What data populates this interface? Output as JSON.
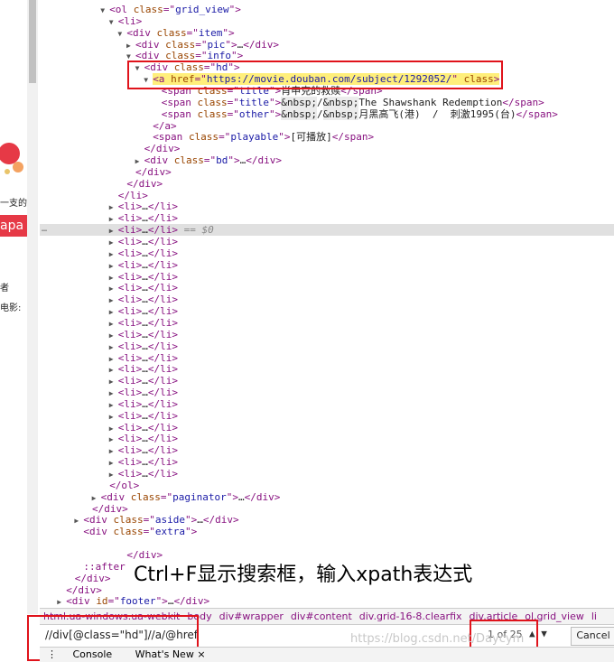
{
  "left_page": {
    "text1": "一支的",
    "text2": "apa",
    "text3": "者",
    "text4": "电影:"
  },
  "dom_lines": [
    {
      "indent": 7,
      "arrow": "▼",
      "parts": [
        [
          "tag",
          "<ol "
        ],
        [
          "attr",
          "class"
        ],
        [
          "tag",
          "=\""
        ],
        [
          "val",
          "grid_view"
        ],
        [
          "tag",
          "\">"
        ]
      ]
    },
    {
      "indent": 8,
      "arrow": "▼",
      "parts": [
        [
          "tag",
          "<li>"
        ]
      ]
    },
    {
      "indent": 9,
      "arrow": "▼",
      "parts": [
        [
          "tag",
          "<div "
        ],
        [
          "attr",
          "class"
        ],
        [
          "tag",
          "=\""
        ],
        [
          "val",
          "item"
        ],
        [
          "tag",
          "\">"
        ]
      ]
    },
    {
      "indent": 10,
      "arrow": "▶",
      "parts": [
        [
          "tag",
          "<div "
        ],
        [
          "attr",
          "class"
        ],
        [
          "tag",
          "=\""
        ],
        [
          "val",
          "pic"
        ],
        [
          "tag",
          "\">"
        ],
        [
          "txt",
          "…"
        ],
        [
          "tag",
          "</div>"
        ]
      ]
    },
    {
      "indent": 10,
      "arrow": "▼",
      "parts": [
        [
          "tag",
          "<div "
        ],
        [
          "attr",
          "class"
        ],
        [
          "tag",
          "=\""
        ],
        [
          "val",
          "info"
        ],
        [
          "tag",
          "\">"
        ]
      ]
    },
    {
      "indent": 11,
      "arrow": "▼",
      "parts": [
        [
          "tag",
          "<div "
        ],
        [
          "attr",
          "class"
        ],
        [
          "tag",
          "=\""
        ],
        [
          "val",
          "hd"
        ],
        [
          "tag",
          "\">"
        ]
      ]
    },
    {
      "indent": 12,
      "arrow": "▼",
      "hl": true,
      "parts": [
        [
          "tag",
          "<a "
        ],
        [
          "attr",
          "href"
        ],
        [
          "tag",
          "=\""
        ],
        [
          "val",
          "https://movie.douban.com/subject/1292052/"
        ],
        [
          "tag",
          "\" "
        ],
        [
          "attr",
          "class"
        ],
        [
          "tag",
          ">"
        ]
      ]
    },
    {
      "indent": 13,
      "arrow": "",
      "parts": [
        [
          "tag",
          "<span "
        ],
        [
          "attr",
          "class"
        ],
        [
          "tag",
          "=\""
        ],
        [
          "val",
          "title"
        ],
        [
          "tag",
          "\">"
        ],
        [
          "txt",
          "肖申克的救赎"
        ],
        [
          "tag",
          "</span>"
        ]
      ]
    },
    {
      "indent": 13,
      "arrow": "",
      "parts": [
        [
          "tag",
          "<span "
        ],
        [
          "attr",
          "class"
        ],
        [
          "tag",
          "=\""
        ],
        [
          "val",
          "title"
        ],
        [
          "tag",
          "\">"
        ],
        [
          "ent",
          "&nbsp;"
        ],
        [
          "txt",
          "/"
        ],
        [
          "ent",
          "&nbsp;"
        ],
        [
          "txt",
          "The Shawshank Redemption"
        ],
        [
          "tag",
          "</span>"
        ]
      ]
    },
    {
      "indent": 13,
      "arrow": "",
      "parts": [
        [
          "tag",
          "<span "
        ],
        [
          "attr",
          "class"
        ],
        [
          "tag",
          "=\""
        ],
        [
          "val",
          "other"
        ],
        [
          "tag",
          "\">"
        ],
        [
          "ent",
          "&nbsp;"
        ],
        [
          "txt",
          "/"
        ],
        [
          "ent",
          "&nbsp;"
        ],
        [
          "txt",
          "月黑高飞(港)  /  刺激1995(台)"
        ],
        [
          "tag",
          "</span>"
        ]
      ]
    },
    {
      "indent": 12,
      "arrow": "",
      "parts": [
        [
          "tag",
          "</a>"
        ]
      ]
    },
    {
      "indent": 12,
      "arrow": "",
      "parts": [
        [
          "tag",
          "<span "
        ],
        [
          "attr",
          "class"
        ],
        [
          "tag",
          "=\""
        ],
        [
          "val",
          "playable"
        ],
        [
          "tag",
          "\">"
        ],
        [
          "txt",
          "[可播放]"
        ],
        [
          "tag",
          "</span>"
        ]
      ]
    },
    {
      "indent": 11,
      "arrow": "",
      "parts": [
        [
          "tag",
          "</div>"
        ]
      ]
    },
    {
      "indent": 11,
      "arrow": "▶",
      "parts": [
        [
          "tag",
          "<div "
        ],
        [
          "attr",
          "class"
        ],
        [
          "tag",
          "=\""
        ],
        [
          "val",
          "bd"
        ],
        [
          "tag",
          "\">"
        ],
        [
          "txt",
          "…"
        ],
        [
          "tag",
          "</div>"
        ]
      ]
    },
    {
      "indent": 10,
      "arrow": "",
      "parts": [
        [
          "tag",
          "</div>"
        ]
      ]
    },
    {
      "indent": 9,
      "arrow": "",
      "parts": [
        [
          "tag",
          "</div>"
        ]
      ]
    },
    {
      "indent": 8,
      "arrow": "",
      "parts": [
        [
          "tag",
          "</li>"
        ]
      ]
    },
    {
      "indent": 8,
      "arrow": "▶",
      "parts": [
        [
          "tag",
          "<li>"
        ],
        [
          "txt",
          "…"
        ],
        [
          "tag",
          "</li>"
        ]
      ]
    },
    {
      "indent": 8,
      "arrow": "▶",
      "parts": [
        [
          "tag",
          "<li>"
        ],
        [
          "txt",
          "…"
        ],
        [
          "tag",
          "</li>"
        ]
      ]
    },
    {
      "indent": 8,
      "arrow": "▶",
      "sel": true,
      "parts": [
        [
          "tag",
          "<li>"
        ],
        [
          "txt",
          "…"
        ],
        [
          "tag",
          "</li>"
        ],
        [
          "dim",
          " == $0"
        ]
      ]
    },
    {
      "indent": 8,
      "arrow": "▶",
      "parts": [
        [
          "tag",
          "<li>"
        ],
        [
          "txt",
          "…"
        ],
        [
          "tag",
          "</li>"
        ]
      ]
    },
    {
      "indent": 8,
      "arrow": "▶",
      "parts": [
        [
          "tag",
          "<li>"
        ],
        [
          "txt",
          "…"
        ],
        [
          "tag",
          "</li>"
        ]
      ]
    },
    {
      "indent": 8,
      "arrow": "▶",
      "parts": [
        [
          "tag",
          "<li>"
        ],
        [
          "txt",
          "…"
        ],
        [
          "tag",
          "</li>"
        ]
      ]
    },
    {
      "indent": 8,
      "arrow": "▶",
      "parts": [
        [
          "tag",
          "<li>"
        ],
        [
          "txt",
          "…"
        ],
        [
          "tag",
          "</li>"
        ]
      ]
    },
    {
      "indent": 8,
      "arrow": "▶",
      "parts": [
        [
          "tag",
          "<li>"
        ],
        [
          "txt",
          "…"
        ],
        [
          "tag",
          "</li>"
        ]
      ]
    },
    {
      "indent": 8,
      "arrow": "▶",
      "parts": [
        [
          "tag",
          "<li>"
        ],
        [
          "txt",
          "…"
        ],
        [
          "tag",
          "</li>"
        ]
      ]
    },
    {
      "indent": 8,
      "arrow": "▶",
      "parts": [
        [
          "tag",
          "<li>"
        ],
        [
          "txt",
          "…"
        ],
        [
          "tag",
          "</li>"
        ]
      ]
    },
    {
      "indent": 8,
      "arrow": "▶",
      "parts": [
        [
          "tag",
          "<li>"
        ],
        [
          "txt",
          "…"
        ],
        [
          "tag",
          "</li>"
        ]
      ]
    },
    {
      "indent": 8,
      "arrow": "▶",
      "parts": [
        [
          "tag",
          "<li>"
        ],
        [
          "txt",
          "…"
        ],
        [
          "tag",
          "</li>"
        ]
      ]
    },
    {
      "indent": 8,
      "arrow": "▶",
      "parts": [
        [
          "tag",
          "<li>"
        ],
        [
          "txt",
          "…"
        ],
        [
          "tag",
          "</li>"
        ]
      ]
    },
    {
      "indent": 8,
      "arrow": "▶",
      "parts": [
        [
          "tag",
          "<li>"
        ],
        [
          "txt",
          "…"
        ],
        [
          "tag",
          "</li>"
        ]
      ]
    },
    {
      "indent": 8,
      "arrow": "▶",
      "parts": [
        [
          "tag",
          "<li>"
        ],
        [
          "txt",
          "…"
        ],
        [
          "tag",
          "</li>"
        ]
      ]
    },
    {
      "indent": 8,
      "arrow": "▶",
      "parts": [
        [
          "tag",
          "<li>"
        ],
        [
          "txt",
          "…"
        ],
        [
          "tag",
          "</li>"
        ]
      ]
    },
    {
      "indent": 8,
      "arrow": "▶",
      "parts": [
        [
          "tag",
          "<li>"
        ],
        [
          "txt",
          "…"
        ],
        [
          "tag",
          "</li>"
        ]
      ]
    },
    {
      "indent": 8,
      "arrow": "▶",
      "parts": [
        [
          "tag",
          "<li>"
        ],
        [
          "txt",
          "…"
        ],
        [
          "tag",
          "</li>"
        ]
      ]
    },
    {
      "indent": 8,
      "arrow": "▶",
      "parts": [
        [
          "tag",
          "<li>"
        ],
        [
          "txt",
          "…"
        ],
        [
          "tag",
          "</li>"
        ]
      ]
    },
    {
      "indent": 8,
      "arrow": "▶",
      "parts": [
        [
          "tag",
          "<li>"
        ],
        [
          "txt",
          "…"
        ],
        [
          "tag",
          "</li>"
        ]
      ]
    },
    {
      "indent": 8,
      "arrow": "▶",
      "parts": [
        [
          "tag",
          "<li>"
        ],
        [
          "txt",
          "…"
        ],
        [
          "tag",
          "</li>"
        ]
      ]
    },
    {
      "indent": 8,
      "arrow": "▶",
      "parts": [
        [
          "tag",
          "<li>"
        ],
        [
          "txt",
          "…"
        ],
        [
          "tag",
          "</li>"
        ]
      ]
    },
    {
      "indent": 8,
      "arrow": "▶",
      "parts": [
        [
          "tag",
          "<li>"
        ],
        [
          "txt",
          "…"
        ],
        [
          "tag",
          "</li>"
        ]
      ]
    },
    {
      "indent": 8,
      "arrow": "▶",
      "parts": [
        [
          "tag",
          "<li>"
        ],
        [
          "txt",
          "…"
        ],
        [
          "tag",
          "</li>"
        ]
      ]
    },
    {
      "indent": 7,
      "arrow": "",
      "parts": [
        [
          "tag",
          "</ol>"
        ]
      ]
    },
    {
      "indent": 6,
      "arrow": "▶",
      "parts": [
        [
          "tag",
          "<div "
        ],
        [
          "attr",
          "class"
        ],
        [
          "tag",
          "=\""
        ],
        [
          "val",
          "paginator"
        ],
        [
          "tag",
          "\">"
        ],
        [
          "txt",
          "…"
        ],
        [
          "tag",
          "</div>"
        ]
      ]
    },
    {
      "indent": 5,
      "arrow": "",
      "parts": [
        [
          "tag",
          "</div>"
        ]
      ]
    },
    {
      "indent": 4,
      "arrow": "▶",
      "parts": [
        [
          "tag",
          "<div "
        ],
        [
          "attr",
          "class"
        ],
        [
          "tag",
          "=\""
        ],
        [
          "val",
          "aside"
        ],
        [
          "tag",
          "\">"
        ],
        [
          "txt",
          "…"
        ],
        [
          "tag",
          "</div>"
        ]
      ]
    },
    {
      "indent": 4,
      "arrow": "",
      "parts": [
        [
          "tag",
          "<div "
        ],
        [
          "attr",
          "class"
        ],
        [
          "tag",
          "=\""
        ],
        [
          "val",
          "extra"
        ],
        [
          "tag",
          "\">"
        ]
      ]
    },
    {
      "indent": 4,
      "arrow": "",
      "parts": []
    },
    {
      "indent": 9,
      "arrow": "",
      "parts": [
        [
          "tag",
          "</div>"
        ]
      ]
    },
    {
      "indent": 4,
      "arrow": "",
      "parts": [
        [
          "tag",
          "::after"
        ]
      ]
    },
    {
      "indent": 3,
      "arrow": "",
      "parts": [
        [
          "tag",
          "</div>"
        ]
      ]
    },
    {
      "indent": 2,
      "arrow": "",
      "parts": [
        [
          "tag",
          "</div>"
        ]
      ]
    },
    {
      "indent": 2,
      "arrow": "▶",
      "parts": [
        [
          "tag",
          "<div "
        ],
        [
          "attr",
          "id"
        ],
        [
          "tag",
          "=\""
        ],
        [
          "val",
          "footer"
        ],
        [
          "tag",
          "\">"
        ],
        [
          "txt",
          "…"
        ],
        [
          "tag",
          "</div>"
        ]
      ]
    }
  ],
  "caption": "Ctrl+F显示搜索框，输入xpath表达式",
  "breadcrumbs": [
    "html.ua-windows.ua-webkit",
    "body",
    "div#wrapper",
    "div#content",
    "div.grid-16-8.clearfix",
    "div.article",
    "ol.grid_view",
    "li"
  ],
  "search": {
    "value": "//div[@class=\"hd\"]//a/@href",
    "match_count": "1 of 25",
    "up": "▲",
    "down": "▼",
    "cancel": "Cancel"
  },
  "bottom_tabs": {
    "menu": "⋮",
    "console": "Console",
    "whatsnew": "What's New",
    "close": "×"
  },
  "watermark": "https://blog.csdn.net/Daycym",
  "dots": "…",
  "colors": {
    "tag": "#881280",
    "attr": "#994500",
    "value": "#1a1aa6",
    "highlight": "#ffef7b",
    "annotation_red": "#e0131b"
  }
}
